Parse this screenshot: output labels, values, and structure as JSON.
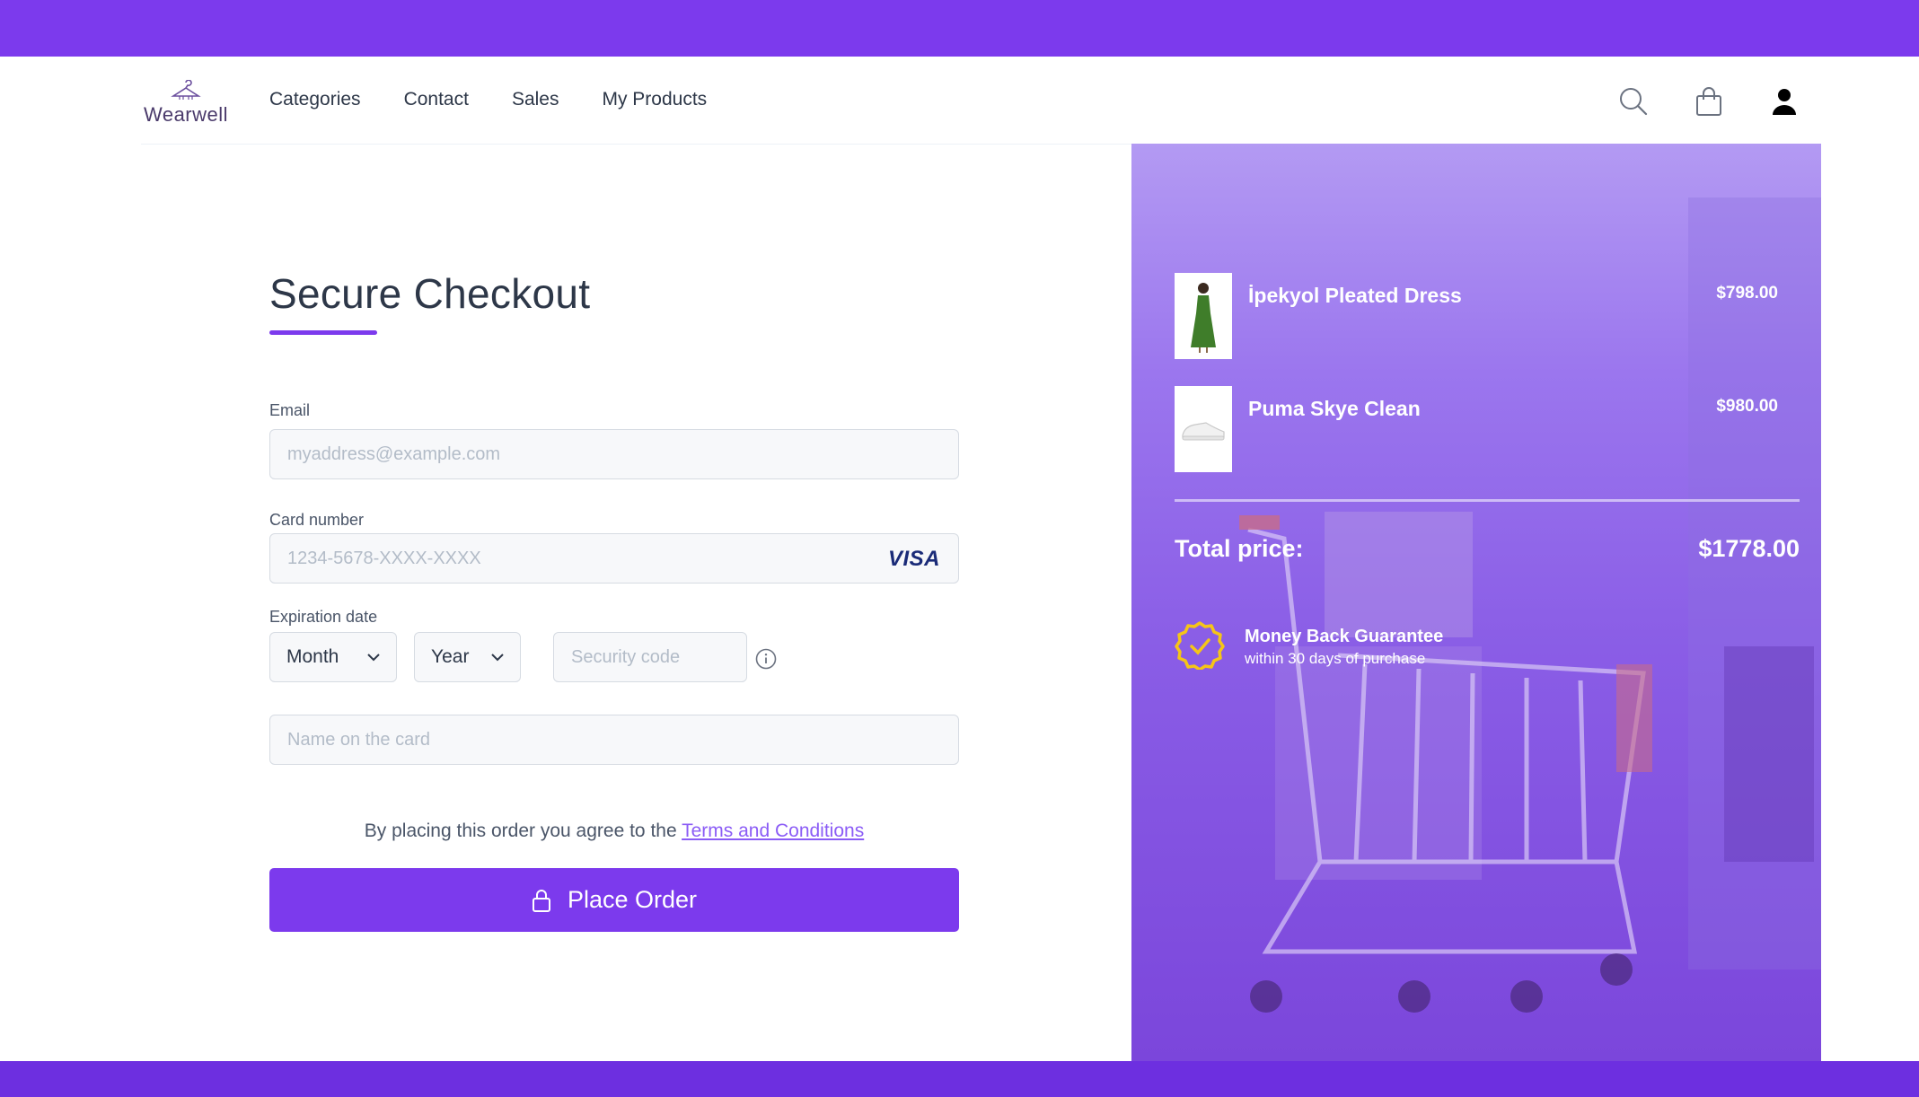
{
  "brand": {
    "name": "Wearwell"
  },
  "nav": {
    "categories": "Categories",
    "contact": "Contact",
    "sales": "Sales",
    "my_products": "My Products"
  },
  "header_icons": [
    "search-icon",
    "shopping-bag-icon",
    "user-icon"
  ],
  "checkout": {
    "title": "Secure Checkout",
    "email_label": "Email",
    "email_placeholder": "myaddress@example.com",
    "card_label": "Card number",
    "card_placeholder": "1234-5678-XXXX-XXXX",
    "card_brand": "VISA",
    "expiration_label": "Expiration date",
    "month_value": "Month",
    "year_value": "Year",
    "security_placeholder": "Security code",
    "name_placeholder": "Name on the card",
    "terms_text": "By placing this order you agree to the ",
    "terms_link": "Terms and Conditions",
    "place_order_label": "Place Order"
  },
  "cart": {
    "items": [
      {
        "name": "İpekyol Pleated Dress",
        "price": "$798.00"
      },
      {
        "name": "Puma Skye Clean",
        "price": "$980.00"
      }
    ],
    "total_label": "Total price:",
    "total_value": "$1778.00",
    "guarantee_title": "Money Back Guarantee",
    "guarantee_sub": "within 30 days of purchase"
  },
  "colors": {
    "accent": "#7c3aed",
    "link": "#8b5cf6",
    "badge": "#f5c518"
  }
}
